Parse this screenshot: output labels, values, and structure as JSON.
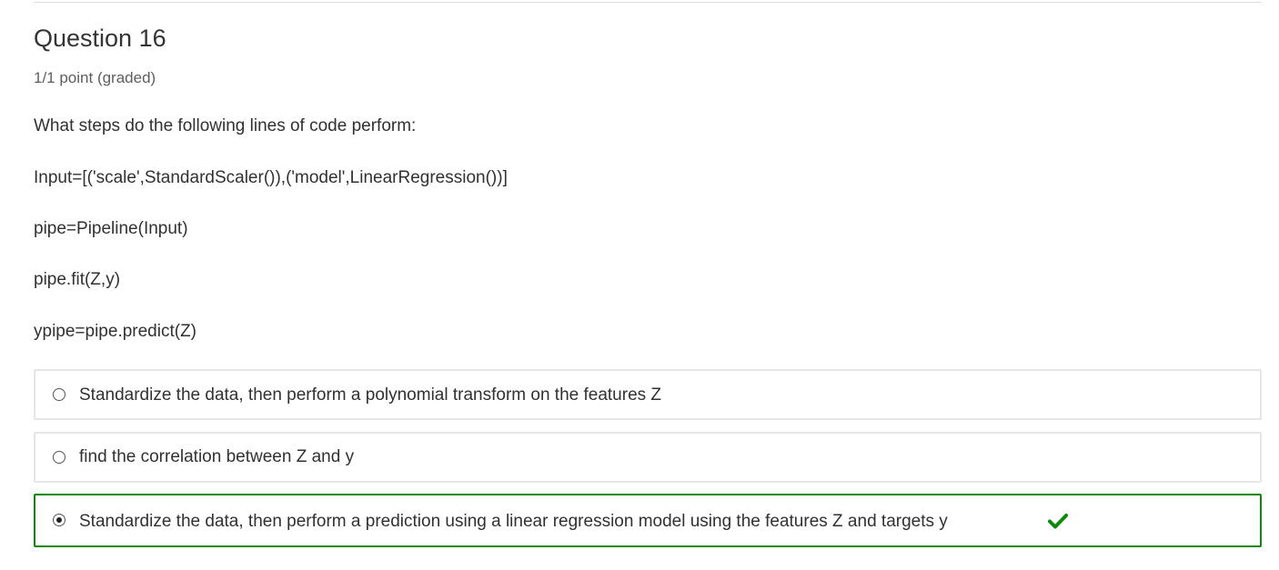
{
  "problem": {
    "title": "Question 16",
    "points": "1/1 point (graded)",
    "prompt_lines": [
      "What steps do the following lines of code perform:",
      "Input=[('scale',StandardScaler()),('model',LinearRegression())]",
      "pipe=Pipeline(Input)",
      "pipe.fit(Z,y)",
      "ypipe=pipe.predict(Z)"
    ],
    "choices": [
      {
        "label": "Standardize the data, then perform a polynomial transform on the features Z",
        "selected": false,
        "correct": false
      },
      {
        "label": "find the correlation between Z and y",
        "selected": false,
        "correct": false
      },
      {
        "label": "Standardize the data, then perform a prediction using a linear regression model using the features Z and targets y",
        "selected": true,
        "correct": true
      }
    ],
    "correct_icon": "checkmark-icon",
    "colors": {
      "correct": "#0d8a0d",
      "border": "#e6e6e6",
      "text": "#313131",
      "muted": "#5e5e5e"
    }
  }
}
